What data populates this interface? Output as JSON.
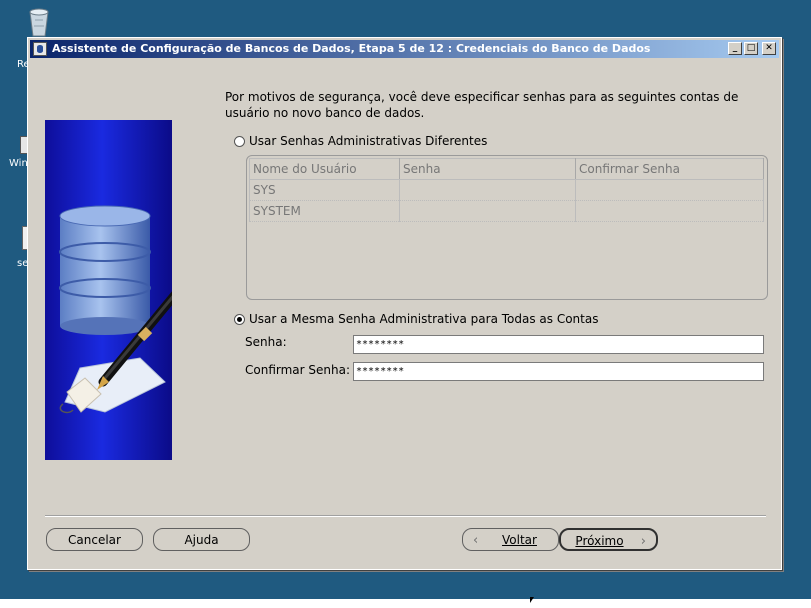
{
  "desktop": {
    "labels": [
      "Re",
      "Win",
      "se"
    ]
  },
  "window": {
    "title": "Assistente de Configuração de Bancos de Dados, Etapa 5 de 12 : Credenciais do Banco de Dados",
    "controls": {
      "minimize": "_",
      "maximize": "□",
      "close": "✕"
    }
  },
  "intro_text": "Por motivos de segurança, você deve especificar senhas para as seguintes contas de usuário no novo banco de dados.",
  "option_different": {
    "label": "Usar Senhas Administrativas Diferentes",
    "selected": false
  },
  "accounts_table": {
    "columns": [
      "Nome do Usuário",
      "Senha",
      "Confirmar Senha"
    ],
    "rows": [
      [
        "SYS",
        "",
        ""
      ],
      [
        "SYSTEM",
        "",
        ""
      ]
    ]
  },
  "option_same": {
    "label": "Usar a Mesma Senha Administrativa para Todas as Contas",
    "selected": true
  },
  "password": {
    "label": "Senha:",
    "value": "********"
  },
  "confirm_password": {
    "label": "Confirmar Senha:",
    "value": "********"
  },
  "buttons": {
    "cancel": "Cancelar",
    "help": "Ajuda",
    "back": "Voltar",
    "next": "Próximo"
  },
  "colors": {
    "titlebar_start": "#0a246a",
    "titlebar_end": "#a6caf0",
    "dialog_bg": "#d4d0c8",
    "desktop_bg": "#1f5a80"
  }
}
